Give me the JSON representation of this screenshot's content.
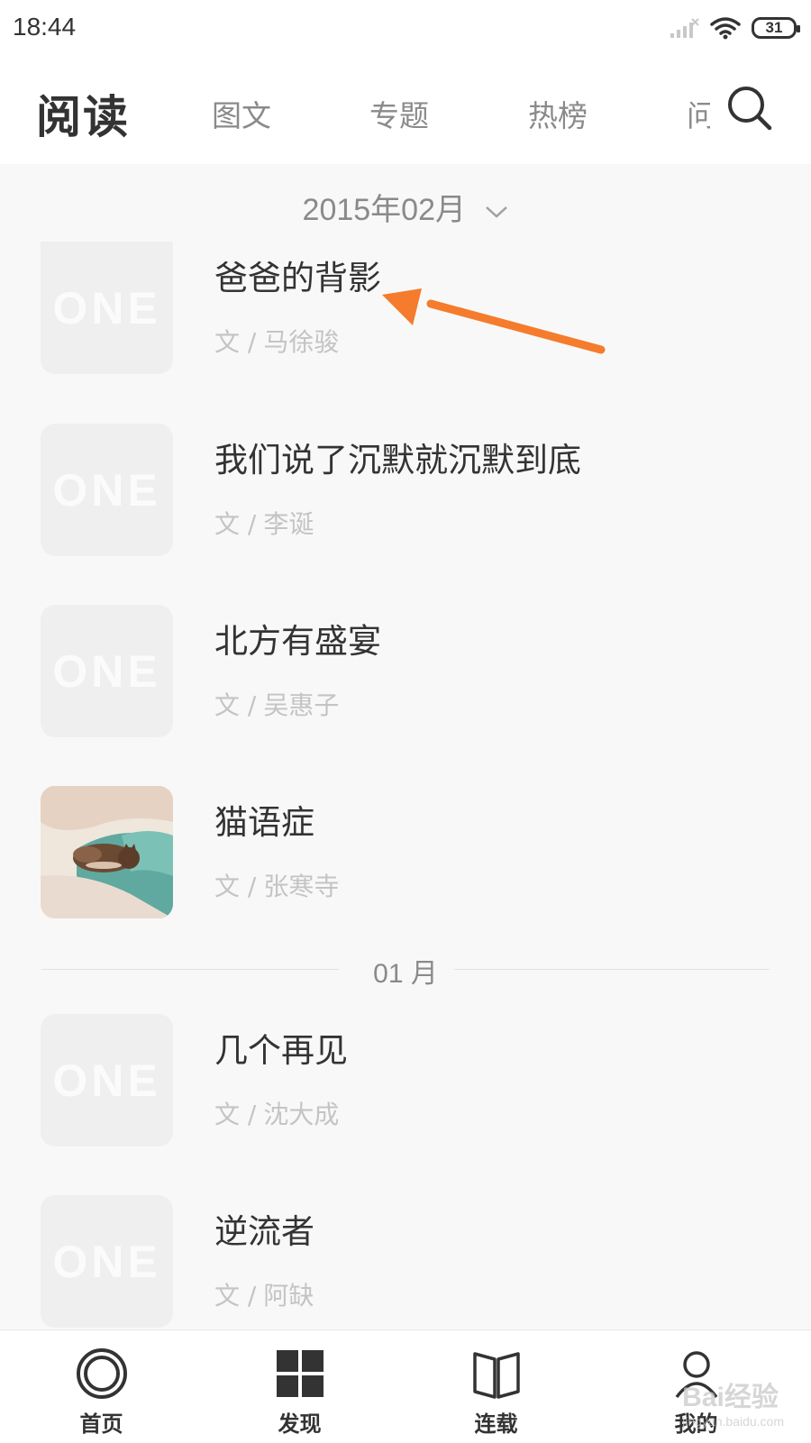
{
  "status_bar": {
    "time": "18:44",
    "battery": "31"
  },
  "header": {
    "title": "阅读",
    "tabs": [
      "图文",
      "专题",
      "热榜",
      "问"
    ]
  },
  "month_picker": {
    "label": "2015年02月"
  },
  "articles": [
    {
      "title": "爸爸的背影",
      "author_prefix": "文 /",
      "author": "马徐骏",
      "thumb": "ONE"
    },
    {
      "title": "我们说了沉默就沉默到底",
      "author_prefix": "文 /",
      "author": "李诞",
      "thumb": "ONE"
    },
    {
      "title": "北方有盛宴",
      "author_prefix": "文 /",
      "author": "吴惠子",
      "thumb": "ONE"
    },
    {
      "title": "猫语症",
      "author_prefix": "文 /",
      "author": "张寒寺",
      "thumb": "photo"
    },
    {
      "title": "几个再见",
      "author_prefix": "文 /",
      "author": "沈大成",
      "thumb": "ONE"
    },
    {
      "title": "逆流者",
      "author_prefix": "文 /",
      "author": "阿缺",
      "thumb": "ONE"
    }
  ],
  "month_divider": {
    "label": "01 月"
  },
  "bottom_nav": [
    {
      "label": "首页",
      "icon": "home-ring-icon"
    },
    {
      "label": "发现",
      "icon": "grid-icon"
    },
    {
      "label": "连载",
      "icon": "book-icon"
    },
    {
      "label": "我的",
      "icon": "person-icon"
    }
  ],
  "watermark": {
    "text": "Bai经验",
    "sub": "jingyan.baidu.com"
  },
  "colors": {
    "annotation_arrow": "#f47c2c",
    "text_primary": "#333333",
    "text_secondary": "#8a8a8a"
  }
}
